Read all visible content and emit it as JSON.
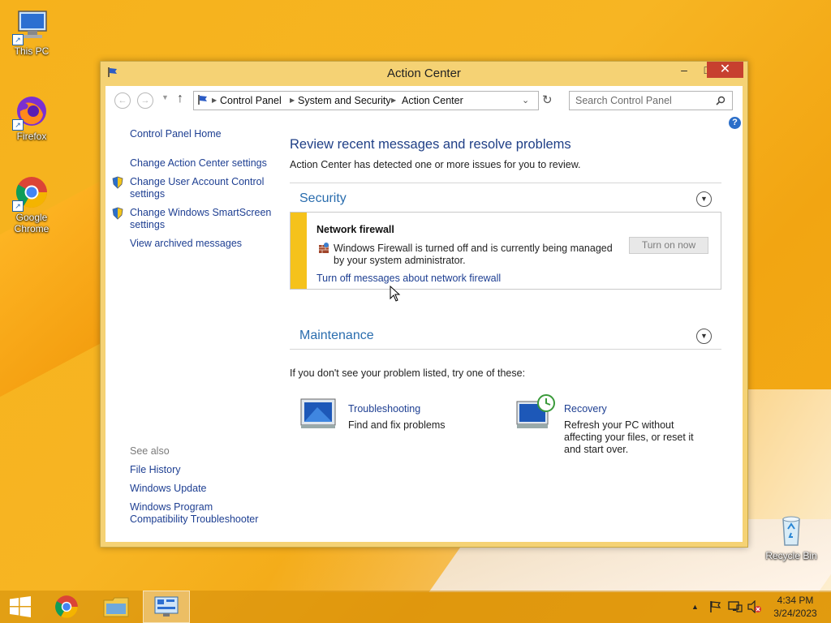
{
  "desktop": {
    "icons": [
      {
        "label": "This PC"
      },
      {
        "label": "Firefox"
      },
      {
        "label": "Google Chrome"
      },
      {
        "label": "Recycle Bin"
      }
    ]
  },
  "window": {
    "title": "Action Center",
    "controls": {
      "minimize": "–",
      "maximize": "□",
      "close": "✕"
    },
    "breadcrumb": [
      "Control Panel",
      "System and Security",
      "Action Center"
    ],
    "search_placeholder": "Search Control Panel",
    "sidebar": {
      "home": "Control Panel Home",
      "links": [
        "Change Action Center settings",
        "Change User Account Control settings",
        "Change Windows SmartScreen settings",
        "View archived messages"
      ],
      "see_also_title": "See also",
      "see_also": [
        "File History",
        "Windows Update",
        "Windows Program Compatibility Troubleshooter"
      ]
    },
    "main": {
      "heading": "Review recent messages and resolve problems",
      "subheading": "Action Center has detected one or more issues for you to review.",
      "security": {
        "title": "Security",
        "alert": {
          "title": "Network firewall",
          "message": "Windows Firewall is turned off and is currently being managed by your system administrator.",
          "button": "Turn on now",
          "link": "Turn off messages about network firewall"
        }
      },
      "maintenance": {
        "title": "Maintenance"
      },
      "hint": "If you don't see your problem listed, try one of these:",
      "troubleshooting": {
        "title": "Troubleshooting",
        "desc": "Find and fix problems"
      },
      "recovery": {
        "title": "Recovery",
        "desc": "Refresh your PC without affecting your files, or reset it and start over."
      }
    }
  },
  "taskbar": {
    "time": "4:34 PM",
    "date": "3/24/2023"
  },
  "colors": {
    "accent_link": "#1e3f92",
    "section_title": "#2a6dae",
    "alert_bar": "#f5c21b",
    "close": "#c7402f"
  }
}
